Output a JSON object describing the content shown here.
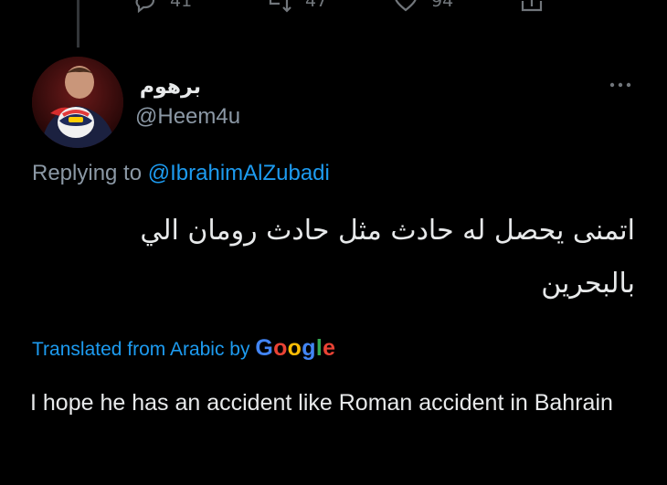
{
  "actions": {
    "reply_count": "41",
    "retweet_count": "47",
    "like_count": "94"
  },
  "tweet": {
    "display_name": "برهوم",
    "handle": "@Heem4u",
    "replying_prefix": "Replying to ",
    "replying_to": "@IbrahimAlZubadi",
    "text": "اتمنى يحصل له حادث مثل حادث رومان الي بالبحرين",
    "translated_label": "Translated from Arabic by ",
    "translation_provider": "Google",
    "translation": "I hope he has an accident like Roman accident in Bahrain"
  },
  "colors": {
    "background": "#000000",
    "text_primary": "#e7e9ea",
    "text_secondary": "#8b98a5",
    "accent": "#1d9bf0",
    "google_blue": "#4285f4",
    "google_red": "#ea4335",
    "google_yellow": "#fbbc05",
    "google_green": "#34a853"
  },
  "icons": {
    "reply": "comment-icon",
    "retweet": "retweet-icon",
    "like": "heart-icon",
    "share": "share-icon",
    "more": "more-dots-icon"
  }
}
